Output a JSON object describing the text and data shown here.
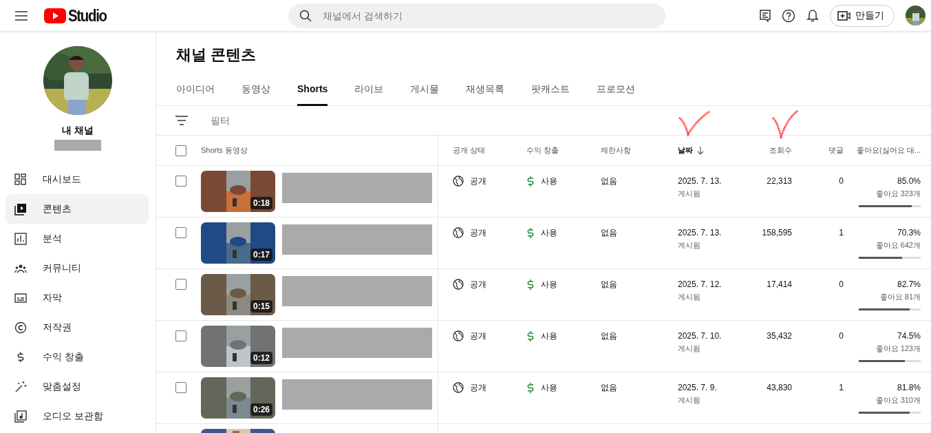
{
  "header": {
    "logo_text": "Studio",
    "search": {
      "placeholder": "채널에서 검색하기"
    },
    "create_button": "만들기"
  },
  "sidebar": {
    "channel_name": "내 채널",
    "items": [
      {
        "label": "대시보드",
        "selected": false
      },
      {
        "label": "콘텐츠",
        "selected": true
      },
      {
        "label": "분석",
        "selected": false
      },
      {
        "label": "커뮤니티",
        "selected": false
      },
      {
        "label": "자막",
        "selected": false
      },
      {
        "label": "저작권",
        "selected": false
      },
      {
        "label": "수익 창출",
        "selected": false
      },
      {
        "label": "맞춤설정",
        "selected": false
      },
      {
        "label": "오디오 보관함",
        "selected": false
      }
    ]
  },
  "page": {
    "title": "채널 콘텐츠",
    "filter": {
      "placeholder": "필터"
    },
    "tabs": [
      {
        "label": "아이디어",
        "selected": false
      },
      {
        "label": "동영상",
        "selected": false
      },
      {
        "label": "Shorts",
        "selected": true
      },
      {
        "label": "라이브",
        "selected": false
      },
      {
        "label": "게시물",
        "selected": false
      },
      {
        "label": "재생목록",
        "selected": false
      },
      {
        "label": "팟캐스트",
        "selected": false
      },
      {
        "label": "프로모션",
        "selected": false
      }
    ]
  },
  "table": {
    "all_selected": false,
    "columns": [
      {
        "label": "Shorts 동영상",
        "sorted": false
      },
      {
        "label": "공개 상태",
        "sorted": false
      },
      {
        "label": "수익 창출",
        "sorted": false
      },
      {
        "label": "제한사항",
        "sorted": false
      },
      {
        "label": "날짜",
        "sorted": true
      },
      {
        "label": "조회수",
        "sorted": false
      },
      {
        "label": "댓글",
        "sorted": false
      },
      {
        "label": "좋아요(싫어요 대...",
        "sorted": false
      }
    ],
    "rows": [
      {
        "checked": false,
        "duration": "0:18",
        "visibility": "공개",
        "monetization": "사용",
        "restrictions": "없음",
        "date": "2025. 7. 13.",
        "date_status": "게시됨",
        "views": "22,313",
        "comments": "0",
        "like_ratio": "85.0%",
        "likes": "좋아요 323개",
        "level": 0.85
      },
      {
        "checked": false,
        "duration": "0:17",
        "visibility": "공개",
        "monetization": "사용",
        "restrictions": "없음",
        "date": "2025. 7. 13.",
        "date_status": "게시됨",
        "views": "158,595",
        "comments": "1",
        "like_ratio": "70.3%",
        "likes": "좋아요 642개",
        "level": 0.703
      },
      {
        "checked": false,
        "duration": "0:15",
        "visibility": "공개",
        "monetization": "사용",
        "restrictions": "없음",
        "date": "2025. 7. 12.",
        "date_status": "게시됨",
        "views": "17,414",
        "comments": "0",
        "like_ratio": "82.7%",
        "likes": "좋아요 81개",
        "level": 0.827
      },
      {
        "checked": false,
        "duration": "0:12",
        "visibility": "공개",
        "monetization": "사용",
        "restrictions": "없음",
        "date": "2025. 7. 10.",
        "date_status": "게시됨",
        "views": "35,432",
        "comments": "0",
        "like_ratio": "74.5%",
        "likes": "좋아요 123개",
        "level": 0.745
      },
      {
        "checked": false,
        "duration": "0:26",
        "visibility": "공개",
        "monetization": "사용",
        "restrictions": "없음",
        "date": "2025. 7. 9.",
        "date_status": "게시됨",
        "views": "43,830",
        "comments": "1",
        "like_ratio": "81.8%",
        "likes": "좋아요 310개",
        "level": 0.818
      }
    ]
  }
}
